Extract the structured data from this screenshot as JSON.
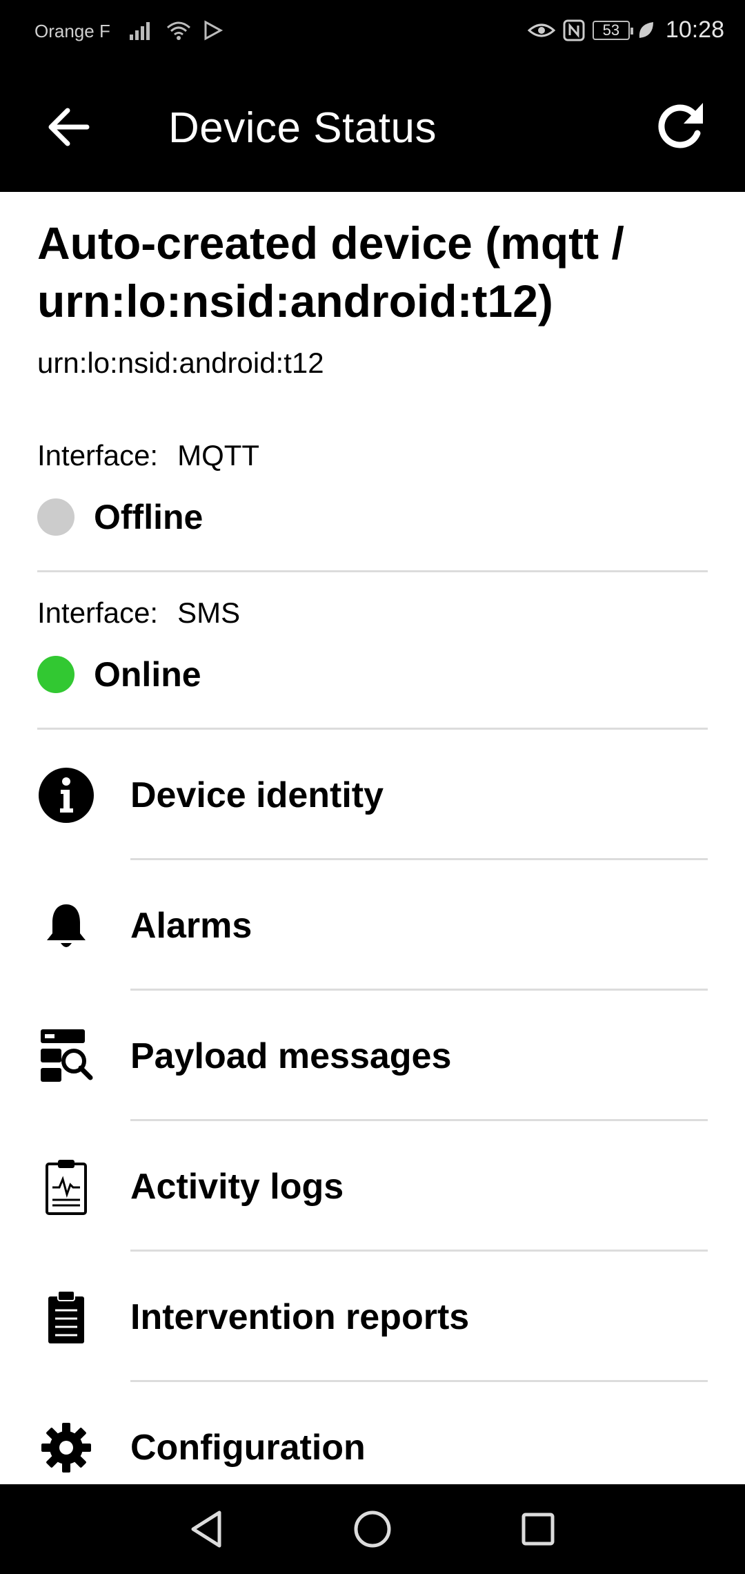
{
  "status_bar": {
    "carrier": "Orange F",
    "battery": "53",
    "time": "10:28"
  },
  "app_bar": {
    "title": "Device Status",
    "back_icon": "arrow-left-icon",
    "refresh_icon": "refresh-icon"
  },
  "device": {
    "title": "Auto-created device (mqtt / urn:lo:nsid:android:t12)",
    "id": "urn:lo:nsid:android:t12"
  },
  "interfaces": [
    {
      "label": "Interface:",
      "name": "MQTT",
      "status": "Offline",
      "color": "#cccccc"
    },
    {
      "label": "Interface:",
      "name": "SMS",
      "status": "Online",
      "color": "#32c832"
    }
  ],
  "menu": [
    {
      "label": "Device identity",
      "icon": "info-icon"
    },
    {
      "label": "Alarms",
      "icon": "bell-icon"
    },
    {
      "label": "Payload messages",
      "icon": "server-search-icon"
    },
    {
      "label": "Activity logs",
      "icon": "clipboard-pulse-icon"
    },
    {
      "label": "Intervention reports",
      "icon": "clipboard-list-icon"
    },
    {
      "label": "Configuration",
      "icon": "gear-icon"
    }
  ],
  "nav": {
    "back_icon": "nav-back-icon",
    "home_icon": "nav-home-icon",
    "recents_icon": "nav-recents-icon"
  }
}
